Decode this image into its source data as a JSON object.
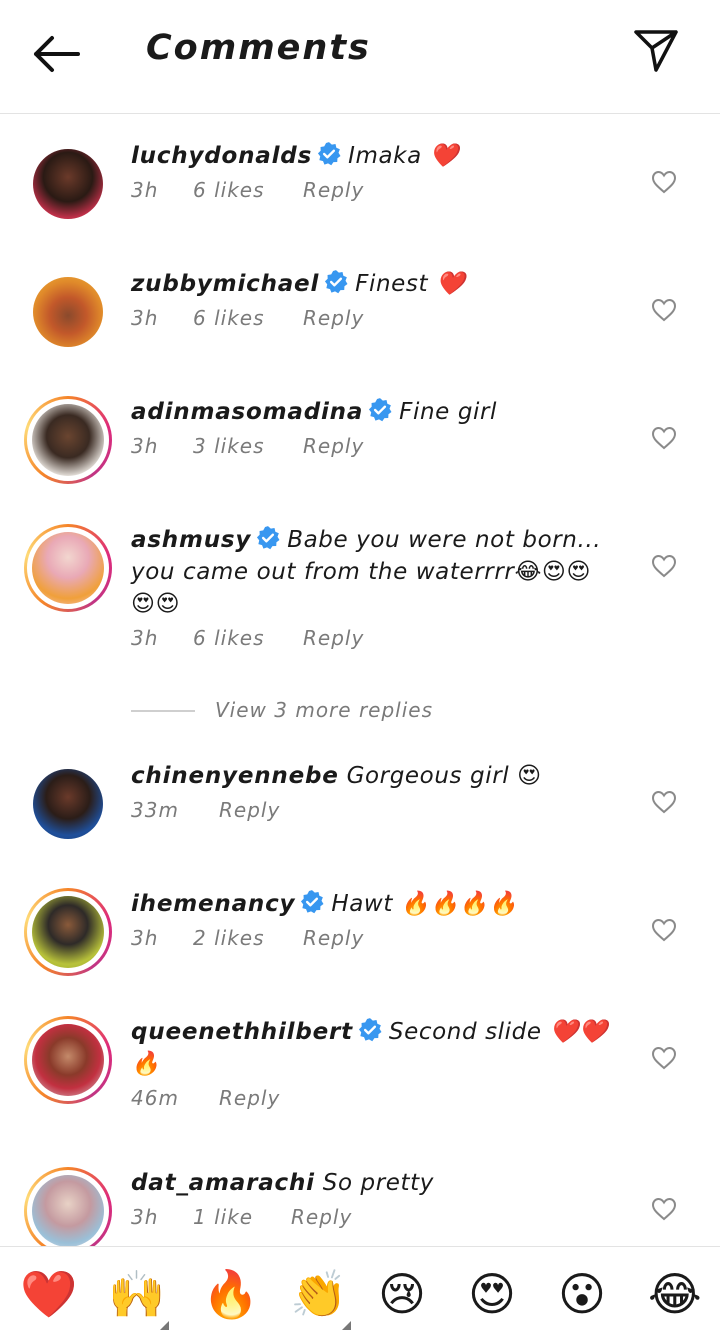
{
  "header": {
    "title": "Comments",
    "back_icon": "arrow-left-icon",
    "share_icon": "paper-plane-icon"
  },
  "comments": [
    {
      "username": "luchydonalds",
      "verified": true,
      "text": "Imaka ❤️",
      "time": "3h",
      "likes": "6 likes",
      "reply": "Reply"
    },
    {
      "username": "zubbymichael",
      "verified": true,
      "text": "Finest ❤️",
      "time": "3h",
      "likes": "6 likes",
      "reply": "Reply"
    },
    {
      "username": "adinmasomadina",
      "verified": true,
      "text": "Fine girl",
      "time": "3h",
      "likes": "3 likes",
      "reply": "Reply"
    },
    {
      "username": "ashmusy",
      "verified": true,
      "text": "Babe you were not born...",
      "text2": "you came out from the waterrrr😂😍😍",
      "text3": "😍😍",
      "time": "3h",
      "likes": "6 likes",
      "reply": "Reply"
    },
    {
      "username": "chinenyennebe",
      "verified": false,
      "text": "Gorgeous girl 😍",
      "time": "33m",
      "likes": "",
      "reply": "Reply"
    },
    {
      "username": "ihemenancy",
      "verified": true,
      "text": "Hawt 🔥🔥🔥🔥",
      "time": "3h",
      "likes": "2 likes",
      "reply": "Reply"
    },
    {
      "username": "queenethhilbert",
      "verified": true,
      "text": "Second slide ❤️❤️",
      "text2": "🔥",
      "time": "46m",
      "likes": "",
      "reply": "Reply"
    },
    {
      "username": "dat_amarachi",
      "verified": false,
      "text": "So pretty",
      "time": "3h",
      "likes": "1 like",
      "reply": "Reply"
    }
  ],
  "view_more": "View 3 more replies",
  "emoji_bar": [
    "❤️",
    "🙌",
    "🔥",
    "👏",
    "😢",
    "😍",
    "😮",
    "😂"
  ],
  "colors": {
    "verified": "#3897f0",
    "meta": "#7a7a7a",
    "heart": "#e0245e"
  }
}
